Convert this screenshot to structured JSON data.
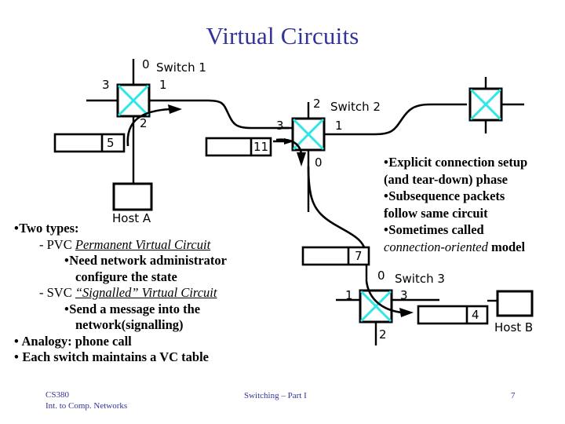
{
  "slide": {
    "title": "Virtual Circuits",
    "title_color": "#333399",
    "background": "#ffffff",
    "switch_x_color": "#33e6e6",
    "line_color": "#000000"
  },
  "diagram": {
    "switch1": {
      "name": "Switch 1",
      "ports": {
        "top": "0",
        "left": "3",
        "right": "1",
        "bottom": "2"
      }
    },
    "switch2": {
      "name": "Switch 2",
      "ports": {
        "top": "2",
        "left": "3",
        "right": "1",
        "bottom": "0"
      }
    },
    "switch3": {
      "name": "Switch 3",
      "ports": {
        "top": "0",
        "left": "1",
        "right": "3",
        "bottom": "2"
      }
    },
    "switch_top_right": {
      "name": "",
      "ports": {}
    },
    "hosts": [
      {
        "label": "Host A"
      },
      {
        "label": "Host B"
      }
    ],
    "packets": [
      {
        "label": "5"
      },
      {
        "label": "11"
      },
      {
        "label": "7"
      },
      {
        "label": "4"
      }
    ]
  },
  "left_bullets": [
    {
      "level": 0,
      "bullet": "•",
      "text": "Two types:"
    },
    {
      "level": 1,
      "bullet": "-",
      "plain": "PVC ",
      "emph": "Permanent Virtual Circuit"
    },
    {
      "level": 2,
      "bullet": "•",
      "text": "Need network administrator"
    },
    {
      "level": 2,
      "cont": "configure the state"
    },
    {
      "level": 1,
      "bullet": "-",
      "plain": "SVC ",
      "emph": "“Signalled” Virtual Circuit"
    },
    {
      "level": 2,
      "bullet": "•",
      "text": "Send a message into the"
    },
    {
      "level": 2,
      "cont": "network(signalling)"
    },
    {
      "level": 0,
      "bullet": "•",
      "text": " Analogy: phone call"
    },
    {
      "level": 0,
      "bullet": "•",
      "text": " Each switch maintains a VC table"
    }
  ],
  "right_bullets": [
    {
      "bullet": "•",
      "text": "Explicit connection setup"
    },
    {
      "cont": "(and tear-down) phase"
    },
    {
      "bullet": "•",
      "text": "Subsequence packets"
    },
    {
      "cont": "follow same circuit"
    },
    {
      "bullet": "•",
      "text": "Sometimes called"
    },
    {
      "cont_emph": "connection-oriented",
      "cont_plain": " model"
    }
  ],
  "footer": {
    "left_line1": "CS380",
    "left_line2": "Int. to Comp. Networks",
    "center": "Switching – Part I",
    "page": "7"
  }
}
